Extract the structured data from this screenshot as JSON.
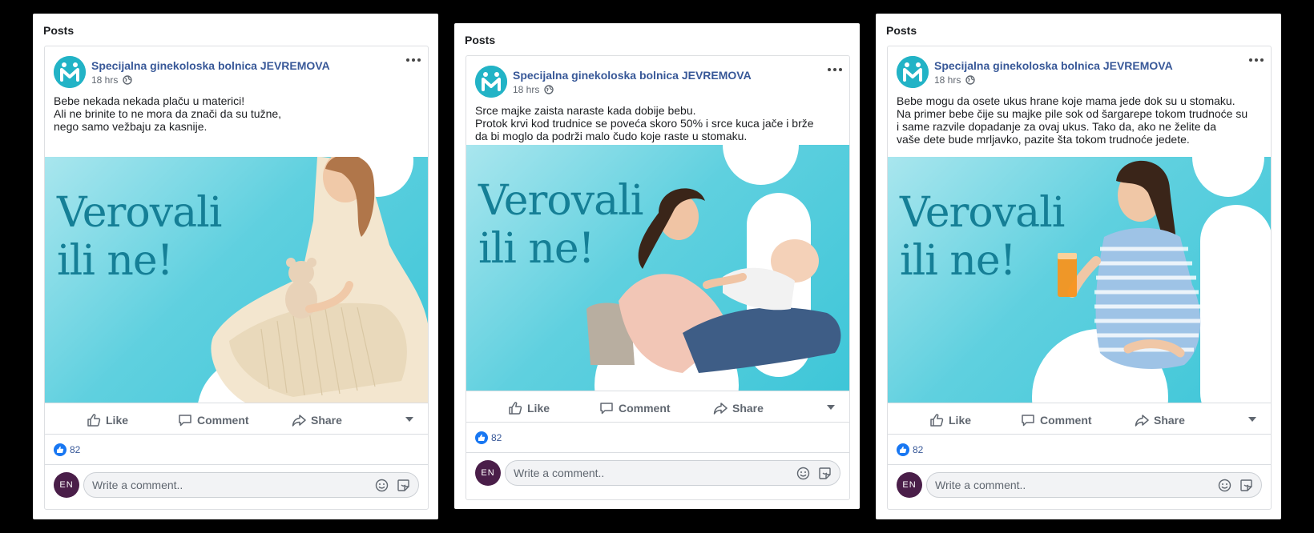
{
  "colors": {
    "page_name": "#385898",
    "brand_teal": "#22b3c6",
    "heading_teal": "#157f96",
    "like_blue": "#1877f2",
    "user_avatar": "#4a1e49"
  },
  "panels": [
    {
      "title": "Posts",
      "post": {
        "page_name": "Specijalna ginekoloska bolnica JEVREMOVA",
        "time": "18 hrs",
        "text": [
          "Bebe nekada nekada plaču u materici!",
          "Ali ne brinite to ne mora da znači da su tužne,",
          "nego samo vežbaju za kasnije."
        ],
        "image_heading": [
          "Verovali",
          "ili ne!"
        ],
        "image_subject": "pregnant-woman-with-teddy-bear",
        "actions": {
          "like": "Like",
          "comment": "Comment",
          "share": "Share"
        },
        "reaction_count": "82",
        "user_initials": "EN",
        "comment_placeholder": "Write a comment.."
      }
    },
    {
      "title": "Posts",
      "post": {
        "page_name": "Specijalna ginekoloska bolnica JEVREMOVA",
        "time": "18 hrs",
        "text": [
          "Srce majke zaista naraste kada dobije bebu.",
          "Protok krvi kod trudnice se poveća skoro 50% i srce kuca jače i brže",
          "da bi moglo da podrži malo čudo koje raste u stomaku."
        ],
        "image_heading": [
          "Verovali",
          "ili ne!"
        ],
        "image_subject": "mother-holding-baby",
        "actions": {
          "like": "Like",
          "comment": "Comment",
          "share": "Share"
        },
        "reaction_count": "82",
        "user_initials": "EN",
        "comment_placeholder": "Write a comment.."
      }
    },
    {
      "title": "Posts",
      "post": {
        "page_name": "Specijalna ginekoloska bolnica JEVREMOVA",
        "time": "18 hrs",
        "text": [
          "Bebe mogu da osete ukus hrane koje mama jede dok su u stomaku.",
          "Na primer bebe čije su majke pile sok od šargarepe tokom trudnoće su",
          "i same razvile dopadanje za ovaj ukus. Tako da, ako ne želite da",
          "vaše dete bude mrljavko, pazite šta tokom trudnoće jedete."
        ],
        "image_heading": [
          "Verovali",
          "ili ne!"
        ],
        "image_subject": "pregnant-woman-with-juice",
        "actions": {
          "like": "Like",
          "comment": "Comment",
          "share": "Share"
        },
        "reaction_count": "82",
        "user_initials": "EN",
        "comment_placeholder": "Write a comment.."
      }
    }
  ]
}
